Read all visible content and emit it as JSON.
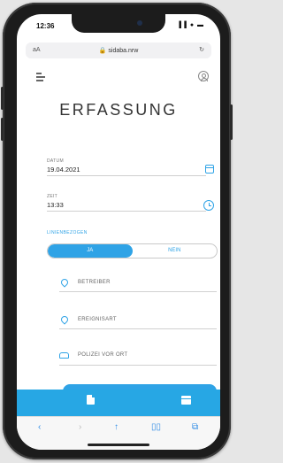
{
  "status_bar": {
    "time": "12:36",
    "icons": "▐▐ ● ▬"
  },
  "browser": {
    "aa": "aA",
    "url": "🔒 sidaba.nrw",
    "reload": "↻"
  },
  "page": {
    "title": "ERFASSUNG"
  },
  "form": {
    "date": {
      "label": "DATUM",
      "value": "19.04.2021"
    },
    "time": {
      "label": "ZEIT",
      "value": "13:33"
    },
    "link_section_label": "LINIENBEZOGEN",
    "toggle": {
      "yes": "JA",
      "no": "NEIN",
      "selected": "JA"
    },
    "operator_placeholder": "BETREIBER",
    "event_type_placeholder": "EREIGNISART",
    "police_placeholder": "POLIZEI VOR ORT"
  },
  "safari_toolbar": {
    "back": "‹",
    "forward": "›",
    "share": "↑",
    "bookmarks": "▯▯",
    "tabs": "⧉"
  },
  "colors": {
    "accent": "#2fa3e6",
    "bottom_bar": "#27a7e4"
  }
}
